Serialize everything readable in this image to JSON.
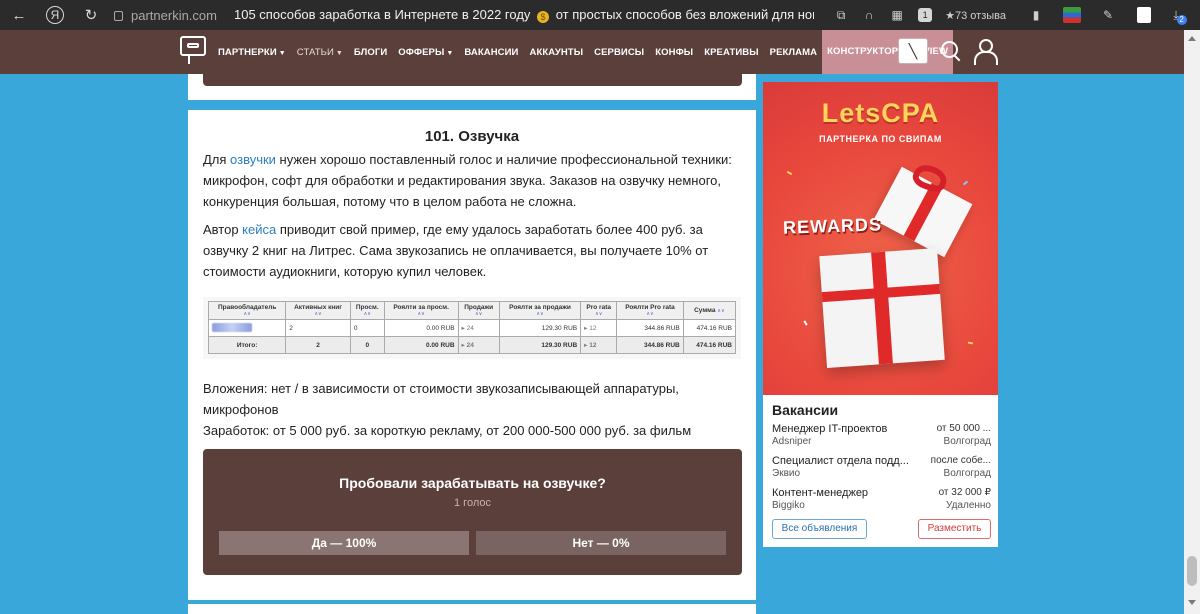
{
  "browser": {
    "url": "partnerkin.com",
    "tab_title_pre": "105 способов заработка в Интернете в 2022 году",
    "tab_title_post": "от простых способов без вложений для нови...",
    "reviews": "73 отзыва",
    "badge_count": "1",
    "download_badge": "2"
  },
  "nav": {
    "items": [
      {
        "label": "ПАРТНЕРКИ",
        "caret": true
      },
      {
        "label": "СТАТЬИ",
        "caret": true
      },
      {
        "label": "БЛОГИ"
      },
      {
        "label": "ОФФЕРЫ",
        "caret": true
      },
      {
        "label": "ВАКАНСИИ"
      },
      {
        "label": "АККАУНТЫ"
      },
      {
        "label": "СЕРВИСЫ"
      },
      {
        "label": "КОНФЫ"
      },
      {
        "label": "КРЕАТИВЫ"
      },
      {
        "label": "РЕКЛАМА"
      },
      {
        "label": "КОНСТРУКТОР WEBVIEW"
      }
    ]
  },
  "article": {
    "heading": "101. Озвучка",
    "p1_pre": "Для ",
    "p1_link": "озвучки",
    "p1_post": " нужен хорошо поставленный голос и наличие профессиональной техники: микрофон, софт для обработки и редактирования звука. Заказов на озвучку немного, конкуренция большая, потому что в целом работа не сложна.",
    "p2_pre": "Автор ",
    "p2_link": "кейса",
    "p2_post": " приводит свой пример, где ему удалось заработать более 400 руб. за озвучку 2 книг на Литрес. Сама звукозапись не оплачивается, вы получаете 10% от стоимости аудиокниги, которую купил человек.",
    "investments": "Вложения: нет / в зависимости от стоимости звукозаписывающей аппаратуры, микрофонов",
    "earnings": "Заработок: от 5 000 руб. за короткую рекламу, от 200 000-500 000 руб. за фильм"
  },
  "table": {
    "headers": [
      "Правообладатель",
      "Активных книг",
      "Просм.",
      "Роялти за просм.",
      "Продажи",
      "Роялти за продажи",
      "Pro rata",
      "Роялти Pro rata",
      "Сумма"
    ],
    "sort_glyph": "∧∨",
    "row": [
      "",
      "2",
      "0",
      "0.00 RUB",
      "24",
      "129.30 RUB",
      "12",
      "344.86 RUB",
      "474.16 RUB"
    ],
    "total": [
      "Итого:",
      "2",
      "0",
      "0.00 RUB",
      "24",
      "129.30 RUB",
      "12",
      "344.86 RUB",
      "474.16 RUB"
    ]
  },
  "poll": {
    "question": "Пробовали зарабатывать на озвучке?",
    "votes": "1 голос",
    "yes": "Да — 100%",
    "no": "Нет — 0%"
  },
  "ad": {
    "brand": "LetsCPA",
    "tagline": "ПАРТНЕРКА ПО СВИПАМ",
    "rewards": "REWARDS"
  },
  "jobs": {
    "title": "Вакансии",
    "items": [
      {
        "title": "Менеджер IT-проектов",
        "company": "Adsniper",
        "salary": "от 50 000 ...",
        "location": "Волгоград"
      },
      {
        "title": "Специалист отдела подд...",
        "company": "Эквио",
        "salary": "после собе...",
        "location": "Волгоград"
      },
      {
        "title": "Контент-менеджер",
        "company": "Biggiko",
        "salary": "от 32 000 ₽",
        "location": "Удаленно"
      }
    ],
    "all_label": "Все объявления",
    "post_label": "Разместить"
  },
  "colors": {
    "navbar": "#5a3f3b",
    "accent_active": "#c98f97",
    "page_bg": "#3aa7da",
    "link": "#2a7fbf"
  }
}
